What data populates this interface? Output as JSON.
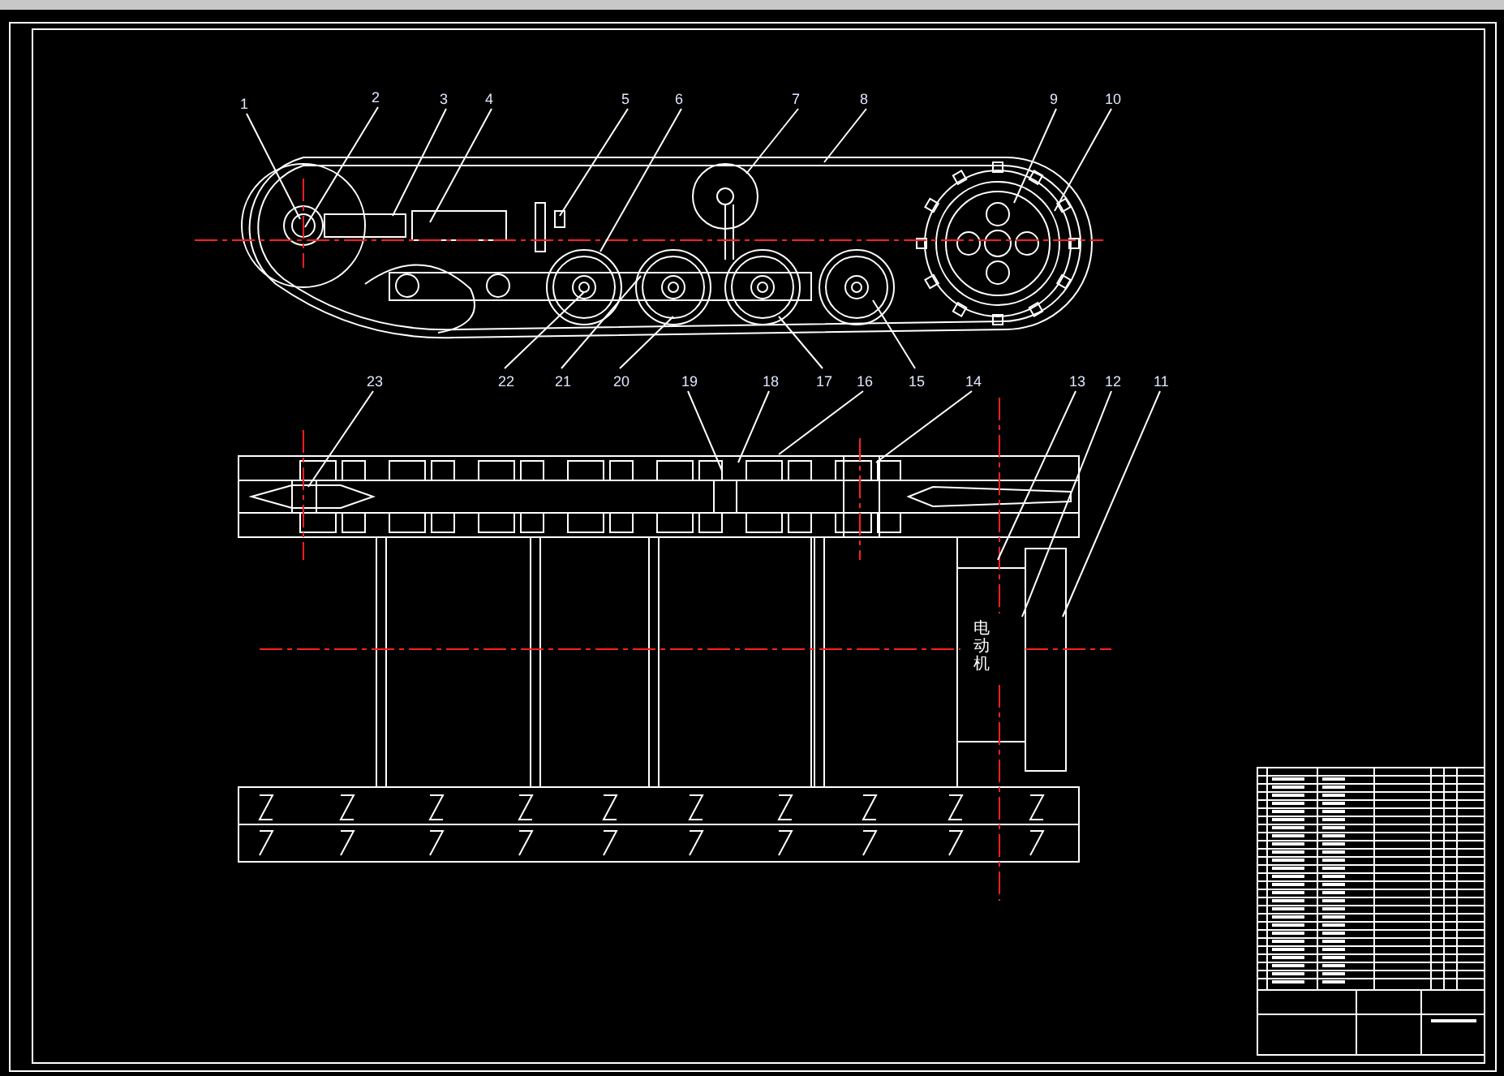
{
  "drawing": {
    "callouts": [
      {
        "number": "1"
      },
      {
        "number": "2"
      },
      {
        "number": "3"
      },
      {
        "number": "4"
      },
      {
        "number": "5"
      },
      {
        "number": "6"
      },
      {
        "number": "7"
      },
      {
        "number": "8"
      },
      {
        "number": "9"
      },
      {
        "number": "10"
      },
      {
        "number": "23"
      },
      {
        "number": "22"
      },
      {
        "number": "21"
      },
      {
        "number": "20"
      },
      {
        "number": "19"
      },
      {
        "number": "18"
      },
      {
        "number": "17"
      },
      {
        "number": "16"
      },
      {
        "number": "15"
      },
      {
        "number": "14"
      },
      {
        "number": "13"
      },
      {
        "number": "12"
      },
      {
        "number": "11"
      }
    ],
    "motor_label": "电动机"
  }
}
